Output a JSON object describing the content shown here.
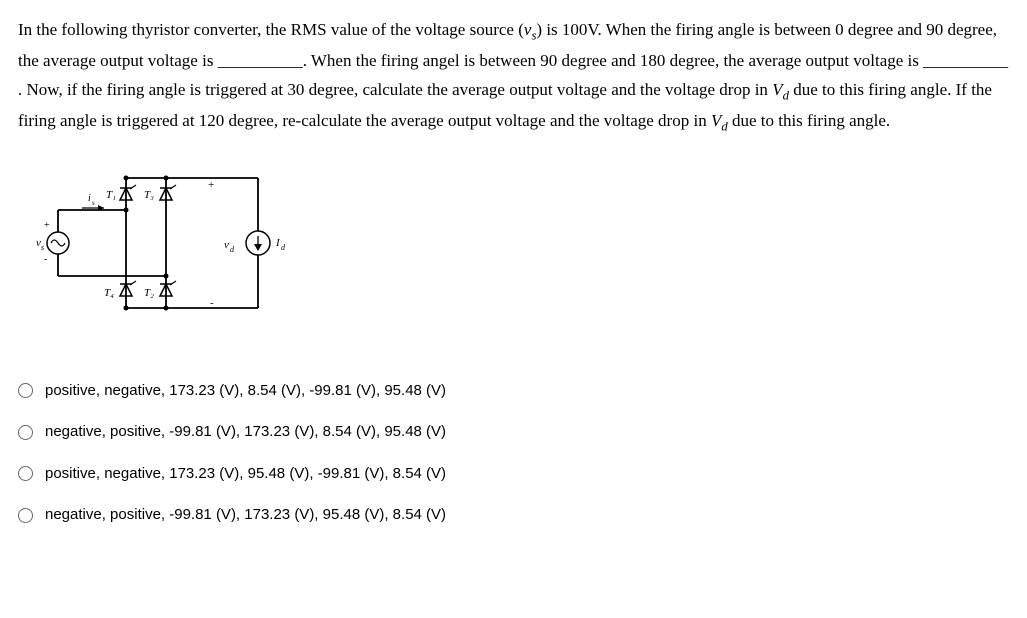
{
  "question": {
    "part1": "In the following thyristor converter, the RMS value of the voltage source (",
    "vs_label": "v",
    "vs_sub": "s",
    "part2": ") is 100V. When the firing angle is between 0 degree and 90 degree, the average output voltage is ",
    "blank1": "__________",
    "part3": ". When the firing angel is between 90 degree and 180 degree, the average output voltage is ",
    "blank2": "__________",
    "part4": ". Now, if the firing angle is triggered at 30 degree, calculate the average output voltage and the voltage drop in ",
    "vd_label": "V",
    "vd_sub": "d",
    "part5": " due to this firing angle. If the firing angle is triggered at 120 degree, re-calculate the average output voltage and the voltage drop in ",
    "part6": " due to this firing angle."
  },
  "circuit": {
    "vs": "v",
    "vs_sub": "s",
    "is": "i",
    "is_sub": "s",
    "t1": "T₁",
    "t2": "T₂",
    "t3": "T₃",
    "t4": "T₄",
    "vd": "v",
    "vd_sub": "d",
    "id": "I",
    "id_sub": "d",
    "plus": "+",
    "minus": "-"
  },
  "options": {
    "a": "positive, negative, 173.23 (V), 8.54 (V), -99.81 (V), 95.48 (V)",
    "b": "negative, positive, -99.81 (V), 173.23 (V), 8.54 (V), 95.48 (V)",
    "c": "positive, negative, 173.23 (V), 95.48 (V), -99.81 (V), 8.54 (V)",
    "d": "negative, positive, -99.81 (V), 173.23 (V), 95.48 (V), 8.54 (V)"
  }
}
